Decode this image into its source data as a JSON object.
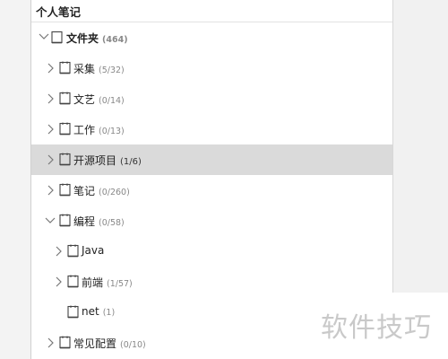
{
  "panel": {
    "title": "个人笔记"
  },
  "tree": {
    "root": {
      "label": "文件夹",
      "count": "(464)"
    },
    "items": [
      {
        "label": "采集",
        "count": "(5/32)"
      },
      {
        "label": "文艺",
        "count": "(0/14)"
      },
      {
        "label": "工作",
        "count": "(0/13)"
      },
      {
        "label": "开源项目",
        "count": "(1/6)"
      },
      {
        "label": "笔记",
        "count": "(0/260)"
      },
      {
        "label": "编程",
        "count": "(0/58)"
      },
      {
        "label": "Java",
        "count": ""
      },
      {
        "label": "前端",
        "count": "(1/57)"
      },
      {
        "label": "net",
        "count": "(1)"
      },
      {
        "label": "常见配置",
        "count": "(0/10)"
      }
    ]
  },
  "watermark": {
    "text": "软件技巧"
  },
  "colors": {
    "selected_row": "#dadada",
    "panel_bg": "#ffffff",
    "count_text": "#888888"
  }
}
